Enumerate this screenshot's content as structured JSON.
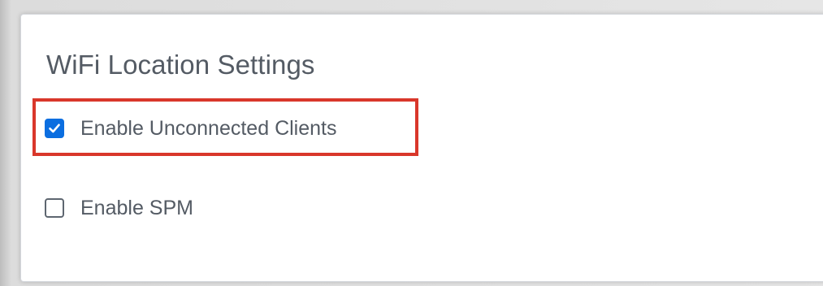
{
  "panel": {
    "title": "WiFi Location Settings"
  },
  "options": [
    {
      "label": "Enable Unconnected Clients",
      "checked": true
    },
    {
      "label": "Enable SPM",
      "checked": false
    }
  ],
  "colors": {
    "accent": "#0b6ee0",
    "highlight": "#d9372b",
    "text": "#545b64"
  },
  "icons": {
    "checked": "checkmark-icon"
  }
}
